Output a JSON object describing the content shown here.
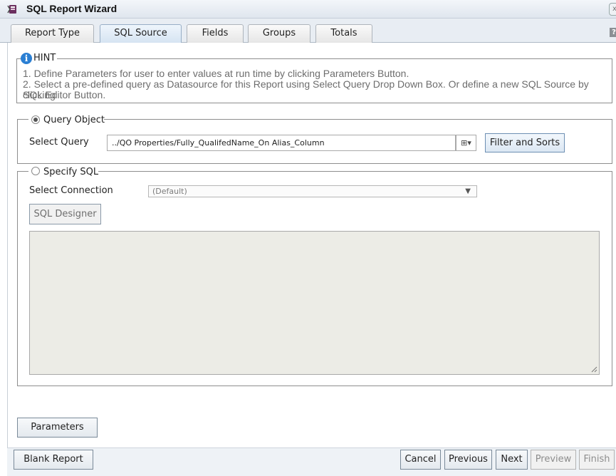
{
  "window": {
    "title": "SQL Report Wizard",
    "close_glyph": "x"
  },
  "tabs": [
    {
      "label": "Report Type"
    },
    {
      "label": "SQL Source"
    },
    {
      "label": "Fields"
    },
    {
      "label": "Groups"
    },
    {
      "label": "Totals"
    }
  ],
  "active_tab": "SQL Source",
  "help_glyph": "?",
  "hint": {
    "icon_glyph": "i",
    "legend": "HINT",
    "line1": "1. Define Parameters for user to enter values at run time by clicking Parameters Button.",
    "line2a": "2. Select a pre-defined query as Datasource for this Report using Select Query Drop Down Box. Or define a new SQL Source by clicking",
    "line2b": "SQL Editor Button."
  },
  "query_object": {
    "legend": "Query Object",
    "selected": true,
    "select_query_label": "Select Query",
    "select_query_value": "../QO Properties/Fully_QualifedName_On Alias_Column",
    "tree_button_glyph": "⊞▾",
    "filter_button": "Filter and Sorts"
  },
  "specify_sql": {
    "legend": "Specify SQL",
    "selected": false,
    "connection_label": "Select Connection",
    "connection_value": "(Default)",
    "dropdown_glyph": "▼",
    "designer_button": "SQL Designer",
    "sql_text": ""
  },
  "parameters_button": "Parameters",
  "footer": {
    "blank_report": "Blank Report",
    "cancel": "Cancel",
    "previous": "Previous",
    "next": "Next",
    "preview": "Preview",
    "finish": "Finish"
  },
  "colors": {
    "accent": "#2b7fd3",
    "tab_active": "#d6e4f2",
    "sql_area_bg": "#ecece6"
  }
}
